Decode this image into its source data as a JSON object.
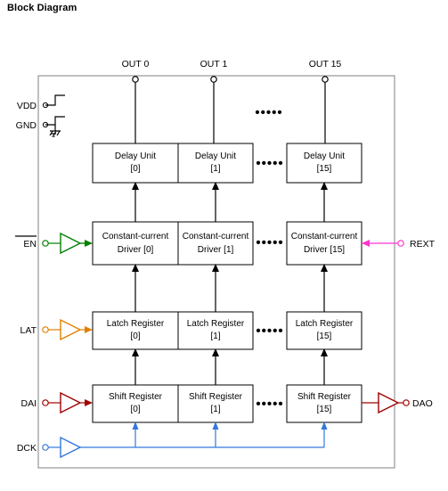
{
  "title": "Block Diagram",
  "outputs": [
    {
      "label": "OUT 0"
    },
    {
      "label": "OUT 1"
    },
    {
      "label": "OUT 15"
    }
  ],
  "power_pins": [
    {
      "label": "VDD"
    },
    {
      "label": "GND"
    }
  ],
  "left_pins": [
    {
      "label": "EN",
      "overline": true,
      "color": "#008000"
    },
    {
      "label": "LAT",
      "overline": false,
      "color": "#e08000"
    },
    {
      "label": "DAI",
      "overline": false,
      "color": "#a00000"
    },
    {
      "label": "DCK",
      "overline": false,
      "color": "#3377dd"
    }
  ],
  "right_pins": [
    {
      "label": "REXT",
      "color": "#ff33cc"
    },
    {
      "label": "DAO",
      "color": "#a00000"
    }
  ],
  "rows": [
    {
      "name": "delay-unit",
      "blocks": [
        {
          "line1": "Delay Unit",
          "line2": "[0]"
        },
        {
          "line1": "Delay Unit",
          "line2": "[1]"
        },
        {
          "line1": "Delay Unit",
          "line2": "[15]"
        }
      ]
    },
    {
      "name": "constant-current-driver",
      "blocks": [
        {
          "line1": "Constant-current",
          "line2": "Driver [0]"
        },
        {
          "line1": "Constant-current",
          "line2": "Driver [1]"
        },
        {
          "line1": "Constant-current",
          "line2": "Driver [15]"
        }
      ]
    },
    {
      "name": "latch-register",
      "blocks": [
        {
          "line1": "Latch Register",
          "line2": "[0]"
        },
        {
          "line1": "Latch Register",
          "line2": "[1]"
        },
        {
          "line1": "Latch Register",
          "line2": "[15]"
        }
      ]
    },
    {
      "name": "shift-register",
      "blocks": [
        {
          "line1": "Shift Register",
          "line2": "[0]"
        },
        {
          "line1": "Shift Register",
          "line2": "[1]"
        },
        {
          "line1": "Shift Register",
          "line2": "[15]"
        }
      ]
    }
  ],
  "ellipsis": "•••••",
  "colors": {
    "en": "#008000",
    "lat": "#e08000",
    "dai": "#a00000",
    "dck": "#3377dd",
    "rext": "#ff33cc",
    "wire": "#000000",
    "box_border": "#000000",
    "background": "#ffffff"
  }
}
